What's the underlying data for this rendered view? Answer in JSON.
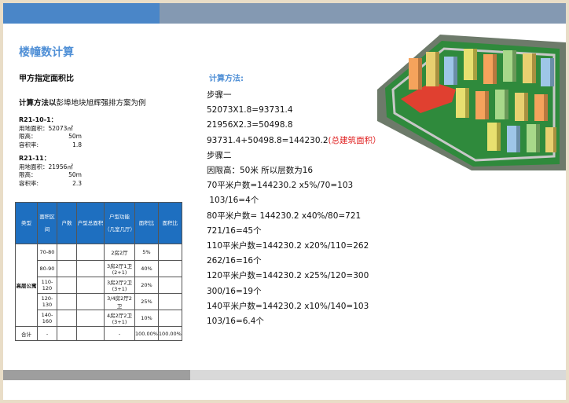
{
  "title": "楼幢数计算",
  "subtitle": "甲方指定面积比",
  "method_prefix": "计算方法以",
  "method_text": "彭埠地块旭辉强排方案为例",
  "plots": [
    {
      "name": "R21-10-1：",
      "land_label": "用地面积：",
      "land_value": "52073㎡",
      "height_label": "限高：",
      "height_value": "50m",
      "far_label": "容积率:",
      "far_value": "1.8"
    },
    {
      "name": "R21-11：",
      "land_label": "用地面积：",
      "land_value": "21956㎡",
      "height_label": "限高：",
      "height_value": "50m",
      "far_label": "容积率:",
      "far_value": "2.3"
    }
  ],
  "table": {
    "headers": [
      "类型",
      "面积区间",
      "户数",
      "户型总面积",
      "户型功能（几室几厅）",
      "面积比",
      "面积比"
    ],
    "type_label": "高层公寓",
    "rows": [
      {
        "range": "70-80",
        "func": "2房2厅",
        "ratio": "5%"
      },
      {
        "range": "80-90",
        "func": "3房2厅1卫(2+1)",
        "ratio": "40%"
      },
      {
        "range": "110-120",
        "func": "3房2厅2卫(3+1)",
        "ratio": "20%"
      },
      {
        "range": "120-130",
        "func": "3/4房2厅2卫",
        "ratio": "25%"
      },
      {
        "range": "140-160",
        "func": "4房2厅2卫(3+1)",
        "ratio": "10%"
      }
    ],
    "total": {
      "label": "合计",
      "range": "-",
      "func": "-",
      "ratio": "100.00%",
      "ratio2": "100.00%"
    }
  },
  "calc_title": "计算方法:",
  "calc_lines": [
    "步骤一",
    "52073X1.8=93731.4",
    "21956X2.3=50498.8",
    "93731.4+50498.8=144230.2",
    "步骤二",
    "因限高：50米   所以层数为16",
    "70平米户数=144230.2 x5%/70=103",
    " 103/16=4个",
    "80平米户数= 144230.2 x40%/80=721",
    "721/16=45个",
    "110平米户数=144230.2 x20%/110=262",
    "262/16=16个",
    "120平米户数=144230.2 x25%/120=300",
    "300/16=19个",
    "140平米户数=144230.2 x10%/140=103",
    "103/16=6.4个"
  ],
  "calc_note": "(总建筑面积）",
  "colors": {
    "accent": "#4f8fd6",
    "table_header": "#1e6fc0",
    "note": "#e02020"
  }
}
